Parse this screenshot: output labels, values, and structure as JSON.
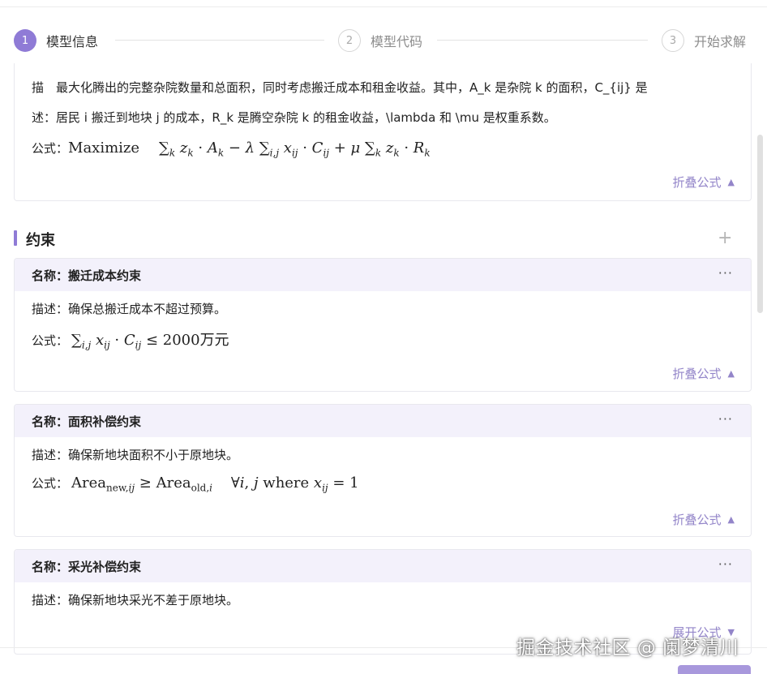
{
  "steps": [
    {
      "num": "1",
      "label": "模型信息"
    },
    {
      "num": "2",
      "label": "模型代码"
    },
    {
      "num": "3",
      "label": "开始求解"
    }
  ],
  "objective": {
    "desc_line1": "描　最大化腾出的完整杂院数量和总面积，同时考虑搬迁成本和租金收益。其中，A_k 是杂院 k 的面积，C_{ij} 是",
    "desc_line2": "述：居民 i 搬迁到地块 j 的成本，R_k 是腾空杂院 k 的租金收益，\\lambda 和 \\mu 是权重系数。",
    "formula_label": "公式：",
    "formula_prefix": "Maximize",
    "fold_label": "折叠公式"
  },
  "constraints_section": {
    "title": "约束",
    "add_label": "+"
  },
  "constraints": [
    {
      "name_label": "名称：搬迁成本约束",
      "desc": "描述：确保总搬迁成本不超过预算。",
      "formula_label": "公式：",
      "formula_unit": "万元",
      "fold_label": "折叠公式"
    },
    {
      "name_label": "名称：面积补偿约束",
      "desc": "描述：确保新地块面积不小于原地块。",
      "formula_label": "公式：",
      "fold_label": "折叠公式"
    },
    {
      "name_label": "名称：采光补偿约束",
      "desc": "描述：确保新地块采光不差于原地块。",
      "fold_label": "展开公式"
    }
  ],
  "more_label": "···",
  "watermark": "掘金技术社区 @ 阑梦清川",
  "colors": {
    "accent": "#8f7bd6",
    "link": "#9385c9",
    "header_bg": "#f3f1fb"
  }
}
